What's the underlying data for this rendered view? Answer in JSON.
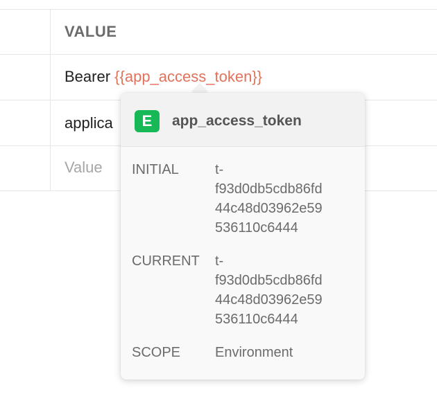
{
  "table": {
    "header": "VALUE",
    "rows": [
      {
        "prefix": "Bearer ",
        "variable": "{{app_access_token}}"
      },
      {
        "value": "applica"
      },
      {
        "placeholder": "Value"
      }
    ]
  },
  "popover": {
    "badge": "E",
    "title": "app_access_token",
    "initial_label": "INITIAL",
    "initial_value": "t-\nf93d0db5cdb86fd\n44c48d03962e59\n536110c6444",
    "current_label": "CURRENT",
    "current_value": "t-\nf93d0db5cdb86fd\n44c48d03962e59\n536110c6444",
    "scope_label": "SCOPE",
    "scope_value": "Environment"
  },
  "colors": {
    "variable": "#e2725b",
    "environment_badge": "#17b856"
  }
}
